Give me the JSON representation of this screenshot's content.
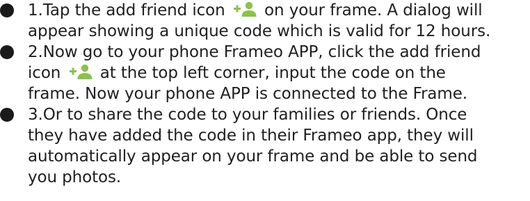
{
  "steps": [
    {
      "lines": [
        [
          "1.Tap the add friend icon ",
          {
            "icon": "add-friend-icon"
          },
          " on your frame. A dialog will"
        ],
        [
          "appear showing a unique code which is valid for 12 hours."
        ]
      ]
    },
    {
      "lines": [
        [
          "2.Now go to your phone Frameo APP, click the add friend"
        ],
        [
          "icon ",
          {
            "icon": "add-friend-icon"
          },
          " at the top left corner, input the code on the"
        ],
        [
          "frame. Now your phone APP is connected to the Frame."
        ]
      ]
    },
    {
      "lines": [
        [
          "3.Or to share the code to your families or friends. Once"
        ],
        [
          "they have added the code in their Frameo app, they will"
        ],
        [
          "automatically appear on your frame and be able to send"
        ],
        [
          "you photos."
        ]
      ]
    }
  ],
  "colors": {
    "icon": "#8ac24a",
    "text": "#1f1f1f",
    "bullet": "#1a1a1a"
  }
}
